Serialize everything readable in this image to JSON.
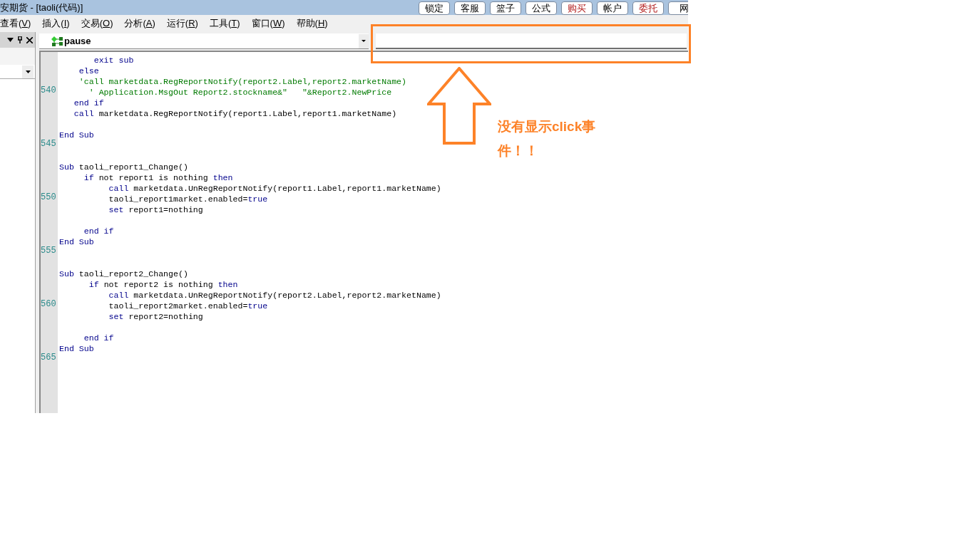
{
  "window": {
    "title": "安期货 - [taoli(代码)]"
  },
  "toolbar_buttons": [
    {
      "label": "锁定",
      "kind": "normal"
    },
    {
      "label": "客服",
      "kind": "normal"
    },
    {
      "label": "篮子",
      "kind": "normal"
    },
    {
      "label": "公式",
      "kind": "normal"
    },
    {
      "label": "购买",
      "kind": "trade"
    },
    {
      "label": "帐户",
      "kind": "normal"
    },
    {
      "label": "委托",
      "kind": "trade"
    },
    {
      "label": "网",
      "kind": "normal"
    }
  ],
  "menu": [
    "查看(V)",
    "插入(I)",
    "交易(O)",
    "分析(A)",
    "运行(R)",
    "工具(T)",
    "窗口(W)",
    "帮助(H)"
  ],
  "editor": {
    "procedure_combo": "pause",
    "lines": [
      {
        "segments": [
          {
            "kind": "keyword",
            "text": "       exit sub"
          }
        ]
      },
      {
        "segments": [
          {
            "kind": "keyword",
            "text": "    else"
          }
        ]
      },
      {
        "segments": [
          {
            "kind": "comment",
            "text": "    'call marketdata.RegReportNotify(report2.Label,report2.marketName)"
          }
        ]
      },
      {
        "number": "540",
        "segments": [
          {
            "kind": "comment",
            "text": "      ' Application.MsgOut Report2.stockname&″   ″&Report2.NewPrice"
          }
        ]
      },
      {
        "segments": [
          {
            "kind": "keyword",
            "text": "   end if"
          }
        ]
      },
      {
        "segments": [
          {
            "kind": "keyword",
            "text": "   call"
          },
          {
            "kind": "plain",
            "text": " marketdata.RegReportNotify(report1.Label,report1.marketName)"
          }
        ]
      },
      {
        "kind": "blank"
      },
      {
        "segments": [
          {
            "kind": "keyword",
            "text": "End Sub"
          }
        ]
      },
      {
        "number": "545"
      },
      {
        "kind": "blank"
      },
      {
        "segments": [
          {
            "kind": "keyword",
            "text": "Sub"
          },
          {
            "kind": "plain",
            "text": " taoli_report1_Change()"
          }
        ]
      },
      {
        "segments": [
          {
            "kind": "keyword",
            "text": "     if"
          },
          {
            "kind": "plain",
            "text": " not report1 is nothing "
          },
          {
            "kind": "keyword",
            "text": "then"
          }
        ]
      },
      {
        "segments": [
          {
            "kind": "keyword",
            "text": "          call"
          },
          {
            "kind": "plain",
            "text": " marketdata.UnRegReportNotify(report1.Label,report1.marketName)"
          }
        ]
      },
      {
        "number": "550",
        "segments": [
          {
            "kind": "plain",
            "text": "          taoli_report1market.enabled="
          },
          {
            "kind": "keyword",
            "text": "true"
          }
        ]
      },
      {
        "segments": [
          {
            "kind": "keyword",
            "text": "          set"
          },
          {
            "kind": "plain",
            "text": " report1=nothing"
          }
        ]
      },
      {
        "kind": "blank"
      },
      {
        "segments": [
          {
            "kind": "keyword",
            "text": "     end if"
          }
        ]
      },
      {
        "segments": [
          {
            "kind": "keyword",
            "text": "End Sub"
          }
        ]
      },
      {
        "number": "555"
      },
      {
        "kind": "blank"
      },
      {
        "segments": [
          {
            "kind": "keyword",
            "text": "Sub"
          },
          {
            "kind": "plain",
            "text": " taoli_report2_Change()"
          }
        ]
      },
      {
        "segments": [
          {
            "kind": "keyword",
            "text": "      if"
          },
          {
            "kind": "plain",
            "text": " not report2 is nothing "
          },
          {
            "kind": "keyword",
            "text": "then"
          }
        ]
      },
      {
        "segments": [
          {
            "kind": "keyword",
            "text": "          call"
          },
          {
            "kind": "plain",
            "text": " marketdata.UnRegReportNotify(report2.Label,report2.marketName)"
          }
        ]
      },
      {
        "number": "560",
        "segments": [
          {
            "kind": "plain",
            "text": "          taoli_report2market.enabled="
          },
          {
            "kind": "keyword",
            "text": "true"
          }
        ]
      },
      {
        "segments": [
          {
            "kind": "keyword",
            "text": "          set"
          },
          {
            "kind": "plain",
            "text": " report2=nothing"
          }
        ]
      },
      {
        "kind": "blank"
      },
      {
        "segments": [
          {
            "kind": "keyword",
            "text": "     end if"
          }
        ]
      },
      {
        "segments": [
          {
            "kind": "keyword",
            "text": "End Sub"
          }
        ]
      },
      {
        "number": "565"
      }
    ]
  },
  "annotation": {
    "text": "没有显示click事件！！"
  }
}
